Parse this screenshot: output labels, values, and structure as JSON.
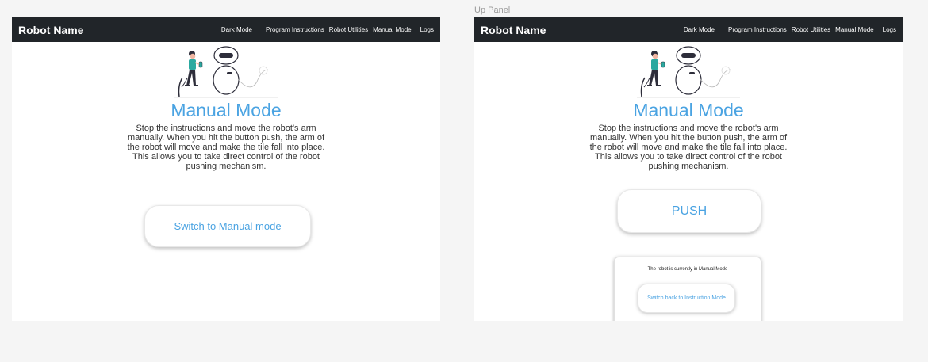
{
  "frame_label": "Up Panel",
  "navbar": {
    "brand": "Robot Name",
    "links": [
      "Dark Mode",
      "Program Instructions",
      "Robot Utilities",
      "Manual Mode",
      "Logs"
    ]
  },
  "content": {
    "title": "Manual Mode",
    "description": "Stop the instructions and move the robot's arm manually. When you hit the button push, the arm of the robot will move and make the tile fall into place. This allows you to take direct control of the robot pushing mechanism."
  },
  "left_panel": {
    "switch_button": "Switch to Manual mode"
  },
  "right_panel": {
    "push_button": "PUSH",
    "status_text": "The robot is currently in Manual Mode",
    "switch_back_button": "Switch back to Instruction Mode"
  },
  "colors": {
    "navbar_bg": "#212529",
    "accent": "#4aa3e2",
    "page_bg": "#f5f5f5"
  }
}
